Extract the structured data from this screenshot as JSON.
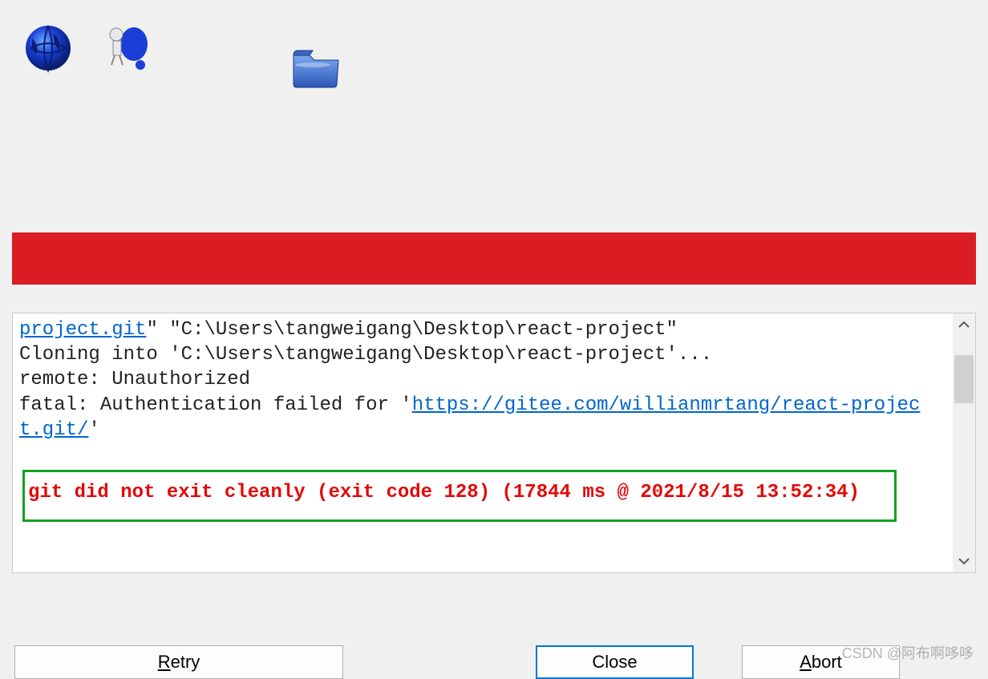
{
  "toolbar": {
    "icon_globe": "globe-icon",
    "icon_robot": "robot-shield-icon",
    "icon_folder": "folder-icon"
  },
  "colors": {
    "error_bar": "#d91d22",
    "link": "#0066cc",
    "error_text": "#e20909",
    "highlight_border": "#0fa321",
    "focus_border": "#0078d7"
  },
  "output": {
    "line1_prefix": "project.git",
    "line1_suffix": "\" \"C:\\Users\\tangweigang\\Desktop\\react-project\"",
    "line2": "Cloning into 'C:\\Users\\tangweigang\\Desktop\\react-project'...",
    "line3": "remote: Unauthorized",
    "line4_prefix": "fatal: Authentication failed for '",
    "line4_link": "https://gitee.com/willianmrtang/react-project.git/",
    "line4_suffix": "'",
    "error": "git did not exit cleanly (exit code 128) (17844 ms @ 2021/8/15 13:52:34)"
  },
  "buttons": {
    "retry": "Retry",
    "retry_accel": "R",
    "retry_rest": "etry",
    "close": "Close",
    "abort": "Abort",
    "abort_accel": "A",
    "abort_rest": "bort"
  },
  "watermark": "CSDN @阿布啊哆哆"
}
